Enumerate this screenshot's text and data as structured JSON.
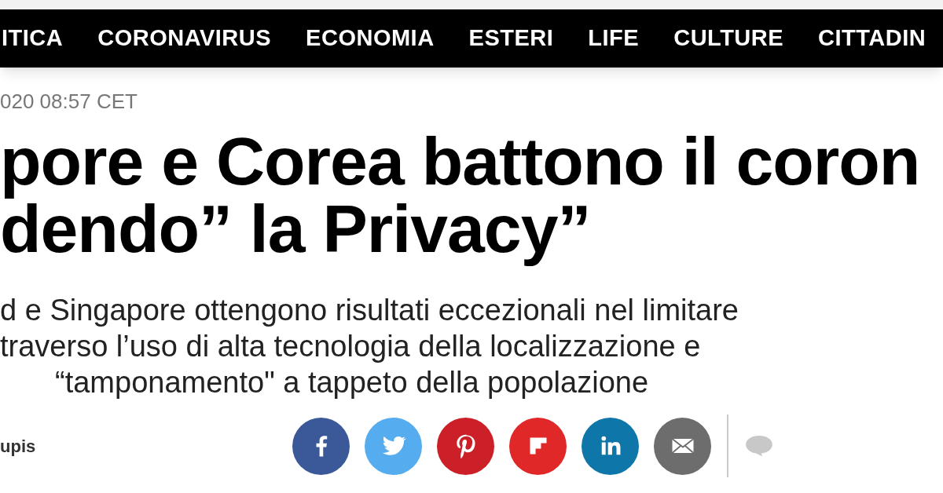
{
  "nav": {
    "items": [
      {
        "label": "ITICA"
      },
      {
        "label": "CORONAVIRUS"
      },
      {
        "label": "ECONOMIA"
      },
      {
        "label": "ESTERI"
      },
      {
        "label": "LIFE"
      },
      {
        "label": "CULTURE"
      },
      {
        "label": "CITTADIN"
      }
    ]
  },
  "article": {
    "date": "020 08:57 CET",
    "headline_lines": [
      "pore e Corea battono il coron",
      "dendo” la Privacy”"
    ],
    "summary_lines": [
      "d e Singapore ottengono risultati eccezionali nel limitare",
      "traverso l’uso di alta tecnologia della localizzazione e",
      "“tamponamento\" a tappeto della popolazione"
    ],
    "author": "upis"
  },
  "share": {
    "buttons": [
      {
        "kind": "facebook",
        "color": "#3b5998"
      },
      {
        "kind": "twitter",
        "color": "#55acee"
      },
      {
        "kind": "pinterest",
        "color": "#cb2027"
      },
      {
        "kind": "flipboard",
        "color": "#e12828"
      },
      {
        "kind": "linkedin",
        "color": "#0e76a8"
      },
      {
        "kind": "email",
        "color": "#6d6d6d"
      }
    ],
    "comments": true
  }
}
